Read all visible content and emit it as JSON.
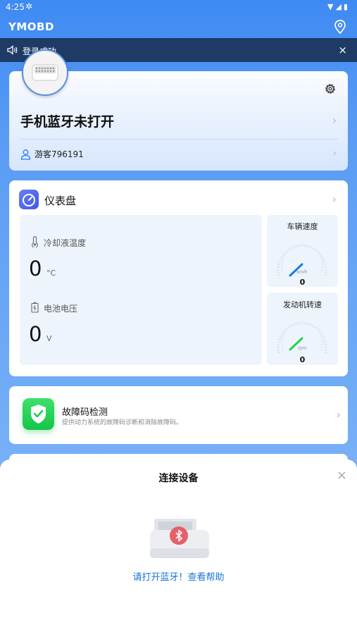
{
  "status_bar": {
    "time": "4:25",
    "icons": "▼◢▮"
  },
  "app_bar": {
    "title": "YMOBD",
    "location_icon": "location-pin-icon"
  },
  "toast": {
    "message": "登录成功",
    "close_glyph": "×"
  },
  "device_card": {
    "bluetooth_state": "手机蓝牙未打开",
    "username": "游客796191",
    "chevron": "›"
  },
  "dashboard": {
    "title": "仪表盘",
    "chevron": "›",
    "coolant": {
      "label": "冷却液温度",
      "value": "0",
      "unit": "°C"
    },
    "battery": {
      "label": "电池电压",
      "value": "0",
      "unit": "V"
    },
    "speed_gauge": {
      "label": "车辆速度",
      "unit": "km/h",
      "value": "0",
      "needle_color": "#1a7ae8"
    },
    "rpm_gauge": {
      "label": "发动机转速",
      "unit": "rpm",
      "value": "0",
      "needle_color": "#22d34a"
    }
  },
  "fault_card": {
    "title": "故障码检测",
    "description": "提供动力系统的故障码诊断和消除故障码。",
    "chevron": "›"
  },
  "connect_sheet": {
    "title": "连接设备",
    "close_glyph": "×",
    "hint": "请打开蓝牙！查看帮助",
    "badge_color": "#e5606a"
  }
}
